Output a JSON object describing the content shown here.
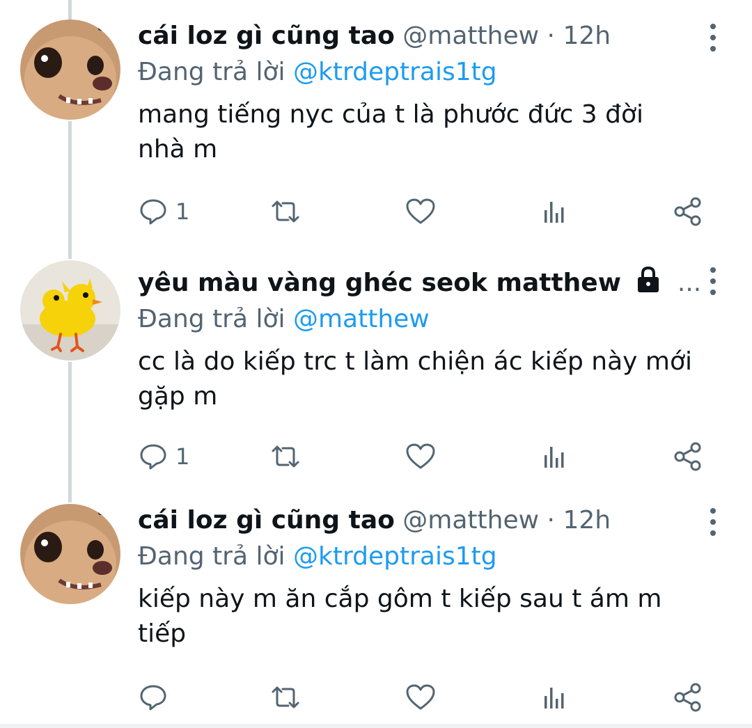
{
  "tweets": [
    {
      "name": "cái loz gì cũng tao",
      "handle": "@matthew",
      "dot": "·",
      "time": "12h",
      "replying_prefix": "Đang trả lời",
      "replying_to": "@ktrdeptrais1tg",
      "text_line1": "mang tiếng nyc của t là phước đức 3 đời",
      "text_line2": "nhà m",
      "reply_count": "1",
      "avatar": "puppy-face"
    },
    {
      "name": "yêu màu vàng ghéc seok matthew",
      "truncation": "...",
      "locked": true,
      "replying_prefix": "Đang trả lời",
      "replying_to": "@matthew",
      "text_line1": "cc là do kiếp trc t làm chiện ác kiếp này mới",
      "text_line2": "gặp m",
      "reply_count": "1",
      "avatar": "yellow-chick"
    },
    {
      "name": "cái loz gì cũng tao",
      "handle": "@matthew",
      "dot": "·",
      "time": "12h",
      "replying_prefix": "Đang trả lời",
      "replying_to": "@ktrdeptrais1tg",
      "text_line1": "kiếp này m ăn cắp gôm t kiếp sau t ám m",
      "text_line2": "tiếp",
      "reply_count": "",
      "avatar": "puppy-face"
    }
  ],
  "colors": {
    "text": "#0f1419",
    "muted": "#536471",
    "link": "#1d9bf0",
    "thread_line": "#cfd9de"
  },
  "icons": [
    "reply-icon",
    "retweet-icon",
    "like-icon",
    "views-icon",
    "share-icon",
    "more-icon",
    "lock-icon"
  ]
}
